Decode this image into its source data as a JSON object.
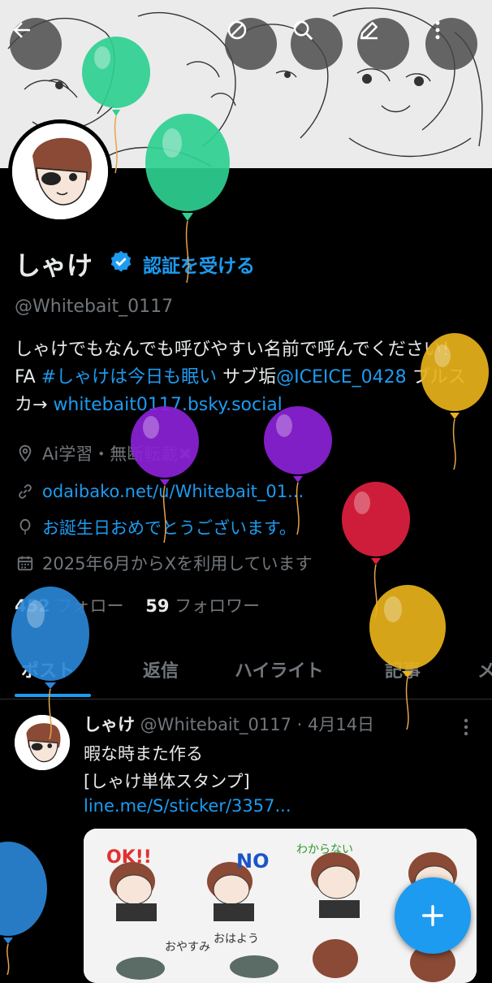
{
  "profile": {
    "name": "しゃけ",
    "verify_label": "認証を受ける",
    "handle": "@Whitebait_0117",
    "bio": {
      "text1": "しゃけでもなんでも呼びやすい名前で呼んでください！ FA ",
      "hashtag": "#しゃけは今日も眠い",
      "text2": " サブ垢",
      "mention": "@ICEICE_0428",
      "text3": " ブルスカ→ ",
      "bsky": "whitebait0117.bsky.social"
    },
    "location": "Ai学習・無断転載✖",
    "website": "odaibako.net/u/Whitebait_01...",
    "birthday": "お誕生日おめでとうございます。",
    "joined": "2025年6月からXを利用しています",
    "following_count": "452",
    "following_label": " フォロー",
    "followers_count": "59",
    "followers_label": " フォロワー"
  },
  "tabs": [
    "ポスト",
    "返信",
    "ハイライト",
    "記事",
    "メ"
  ],
  "post": {
    "name": "しゃけ",
    "meta": " @Whitebait_0117 · 4月14日",
    "line1": "暇な時また作る",
    "line2": "[しゃけ単体スタンプ]",
    "link": "line.me/S/sticker/3357..."
  },
  "stickers": {
    "s1": "OK!!",
    "s2": "NO",
    "s3": "わからない",
    "s4": "おやすみ",
    "s5": "おはよう"
  },
  "icons": {
    "back": "arrow-left-icon",
    "mute": "no-symbol-icon",
    "search": "search-icon",
    "edit": "pencil-icon",
    "more": "more-vertical-icon",
    "compose": "plus-icon"
  },
  "colors": {
    "accent": "#1d9bf0",
    "muted": "#71767b",
    "text": "#e7e9ea",
    "background": "#000000"
  }
}
